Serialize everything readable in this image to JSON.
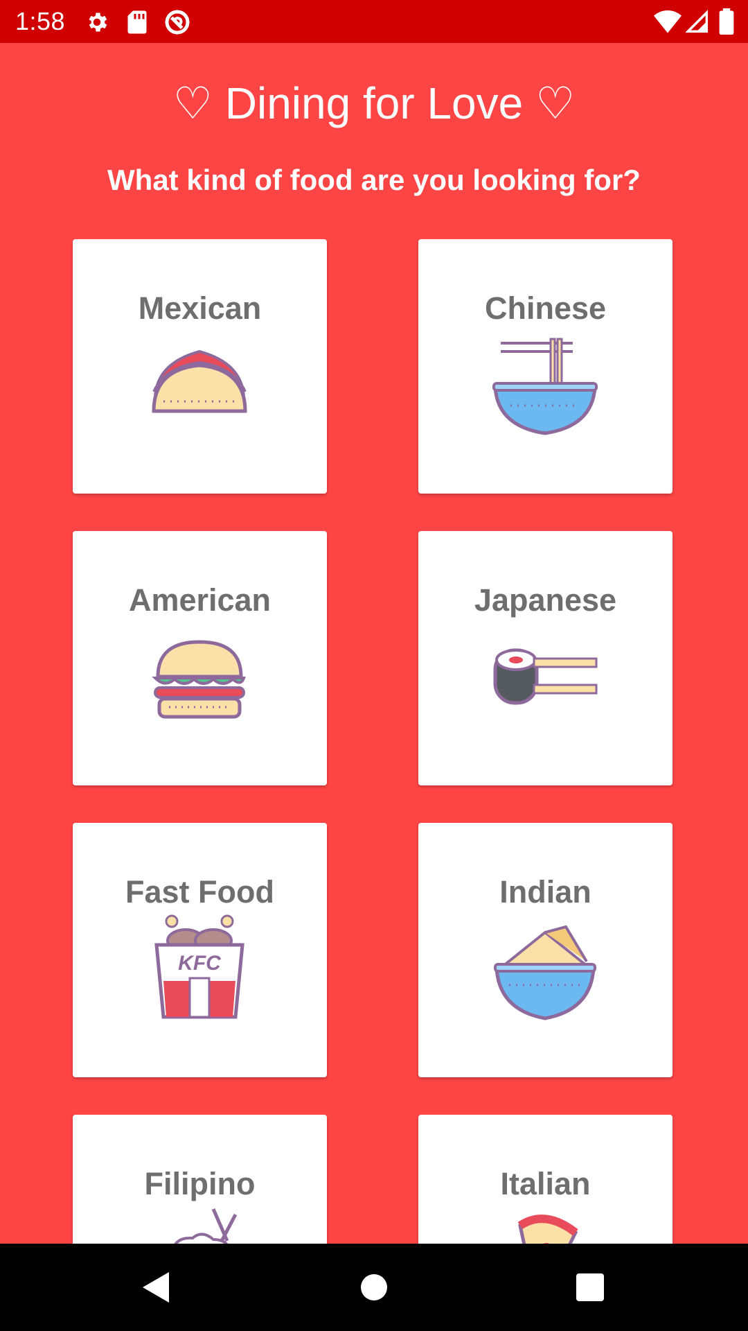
{
  "status_bar": {
    "time": "1:58",
    "icons": [
      "gear-icon",
      "sd-card-icon",
      "do-not-disturb-icon",
      "wifi-icon",
      "cell-signal-icon",
      "battery-icon"
    ]
  },
  "header": {
    "title": "♡ Dining for Love ♡",
    "subtitle": "What kind of food are you looking for?"
  },
  "categories": [
    {
      "label": "Mexican",
      "icon": "taco-icon"
    },
    {
      "label": "Chinese",
      "icon": "noodle-bowl-icon"
    },
    {
      "label": "American",
      "icon": "burger-icon"
    },
    {
      "label": "Japanese",
      "icon": "sushi-icon"
    },
    {
      "label": "Fast Food",
      "icon": "fried-chicken-bucket-icon",
      "icon_text": "KFC"
    },
    {
      "label": "Indian",
      "icon": "curry-bowl-icon"
    },
    {
      "label": "Filipino",
      "icon": "rice-bowl-icon"
    },
    {
      "label": "Italian",
      "icon": "pizza-icon"
    }
  ],
  "colors": {
    "background": "#fe4545",
    "status_bar": "#d10000",
    "card": "#ffffff",
    "card_label": "#6e6e6e",
    "icon_outline": "#8e6a9c"
  },
  "nav_bar": {
    "icons": [
      "back-icon",
      "home-icon",
      "recents-icon"
    ]
  }
}
